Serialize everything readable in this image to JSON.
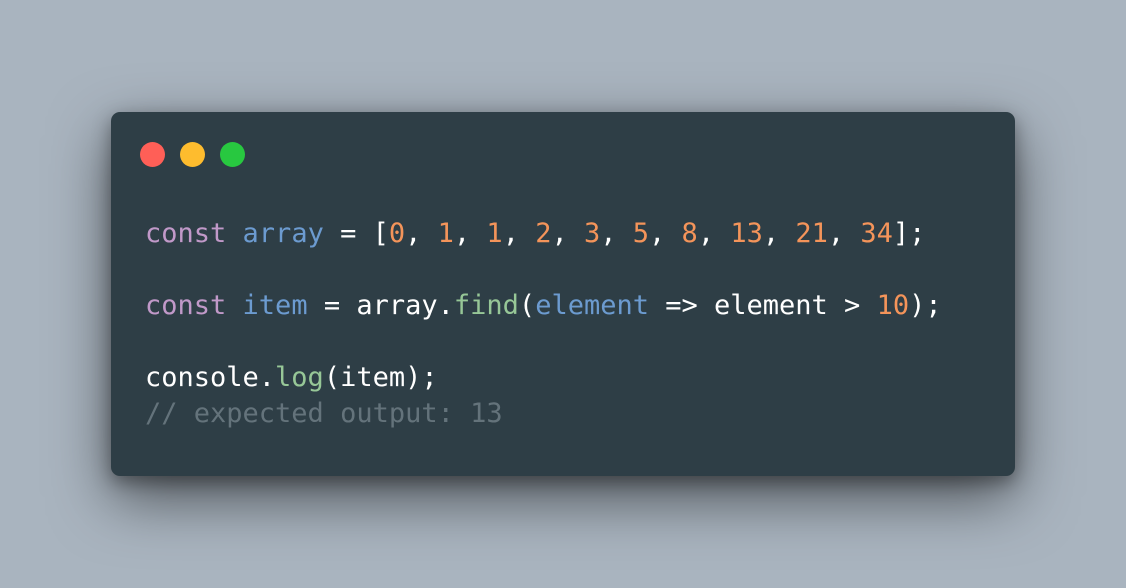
{
  "window": {
    "controls": [
      {
        "name": "close",
        "color": "#ff5f57"
      },
      {
        "name": "minimize",
        "color": "#febc2e"
      },
      {
        "name": "maximize",
        "color": "#28c840"
      }
    ]
  },
  "code": {
    "line1": {
      "kw": "const",
      "name": "array",
      "eq": " = [",
      "nums": [
        "0",
        "1",
        "1",
        "2",
        "3",
        "5",
        "8",
        "13",
        "21",
        "34"
      ],
      "sep": ", ",
      "end": "];"
    },
    "line2": {
      "kw": "const",
      "name": "item",
      "eq": " = array.",
      "method": "find",
      "open": "(",
      "param": "element",
      "arrow": " => element > ",
      "num": "10",
      "end": ");"
    },
    "line3": {
      "obj": "console.",
      "method": "log",
      "args": "(item);"
    },
    "comment": "// expected output: 13"
  },
  "colors": {
    "background": "#a9b4bf",
    "window": "#2e3e46",
    "keyword": "#c199c9",
    "variable": "#6c9bd0",
    "number": "#f4945a",
    "function": "#97c797",
    "comment": "#64737b",
    "text": "#ffffff"
  }
}
